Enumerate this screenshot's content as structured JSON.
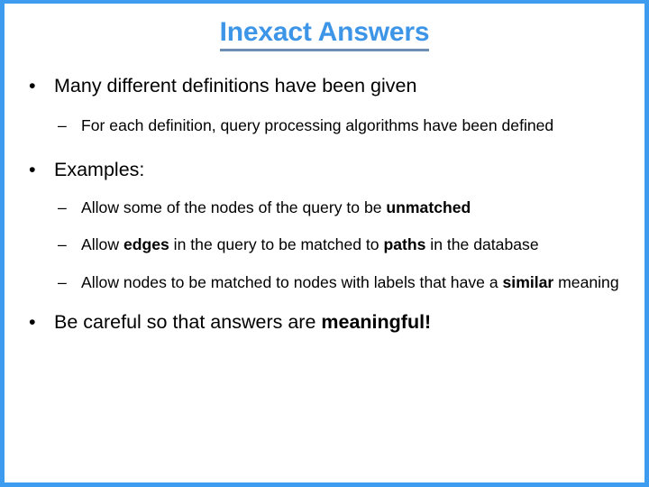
{
  "slide": {
    "title": "Inexact Answers",
    "accent_color": "#3d95e8",
    "border_color": "#3d9bf0",
    "underline_color": "#6e8fb3",
    "text_color": "#000000",
    "bullet_glyph": "•",
    "dash_glyph": "–",
    "content": [
      {
        "level": 1,
        "id": "many-definitions",
        "text": "Many different definitions have been given"
      },
      {
        "level": 2,
        "id": "query-processing-algorithms",
        "text": "For each definition, query processing algorithms have been defined"
      },
      {
        "level": 1,
        "id": "examples",
        "text": "Examples:"
      },
      {
        "level": 2,
        "id": "unmatched-nodes",
        "parts": [
          {
            "text": "Allow some of the nodes of the query to be ",
            "bold": false
          },
          {
            "text": "unmatched",
            "bold": true
          }
        ],
        "plain": "Allow some of the nodes of the query to be unmatched"
      },
      {
        "level": 2,
        "id": "edges-to-paths",
        "parts": [
          {
            "text": "Allow ",
            "bold": false
          },
          {
            "text": "edges",
            "bold": true
          },
          {
            "text": " in the query to be matched to ",
            "bold": false
          },
          {
            "text": "paths",
            "bold": true
          },
          {
            "text": " in the database",
            "bold": false
          }
        ],
        "plain": "Allow edges in the query to be matched to paths in the database"
      },
      {
        "level": 2,
        "id": "similar-labels",
        "parts": [
          {
            "text": "Allow nodes to be matched to nodes with labels that have a ",
            "bold": false
          },
          {
            "text": "similar",
            "bold": true
          },
          {
            "text": " meaning",
            "bold": false
          }
        ],
        "plain": "Allow nodes to be matched to nodes with labels that have a similar meaning"
      },
      {
        "level": 1,
        "id": "be-careful",
        "parts": [
          {
            "text": "Be careful so that answers are ",
            "bold": false
          },
          {
            "text": "meaningful!",
            "bold": true
          }
        ],
        "plain": "Be careful so that answers are meaningful!"
      }
    ]
  }
}
